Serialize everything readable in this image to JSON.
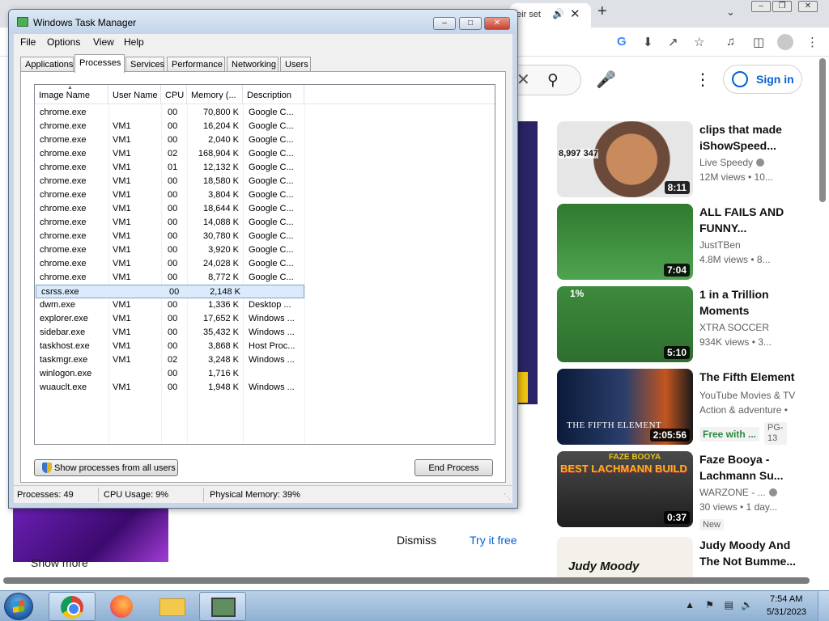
{
  "browser": {
    "tab_title": "eir set",
    "tab_icons": [
      "speaker-icon",
      "close-icon"
    ],
    "new_tab": "+",
    "window_buttons": [
      "minimize",
      "restore",
      "close"
    ],
    "toolbar_icons": [
      "google-icon",
      "download-icon",
      "share-icon",
      "star-icon",
      "media-icon",
      "sidebar-icon",
      "profile-icon",
      "menu-icon"
    ]
  },
  "youtube": {
    "sign_in": "Sign in",
    "dismiss": "Dismiss",
    "try_free": "Try it free",
    "show_more": "Show more",
    "videos": [
      {
        "title": "clips that made\niShowSpeed...",
        "channel": "Live Speedy",
        "verified": true,
        "meta": "12M views • 10...",
        "duration": "8:11",
        "overlay": "8,997 347"
      },
      {
        "title": "ALL FAILS AND\nFUNNY...",
        "channel": "JustTBen",
        "verified": false,
        "meta": "4.8M views • 8...",
        "duration": "7:04"
      },
      {
        "title": "1 in a Trillion\nMoments",
        "channel": "XTRA SOCCER",
        "verified": false,
        "meta": "934K views • 3...",
        "duration": "5:10",
        "overlay": "1%"
      },
      {
        "title": "The Fifth Element",
        "channel": "YouTube Movies & TV",
        "verified": false,
        "meta": "Action & adventure •",
        "duration": "2:05:56",
        "free": "Free with ...",
        "rating": "PG-\n13",
        "overlay": "THE FIFTH ELEMENT"
      },
      {
        "title": "Faze Booya -\nLachmann Su...",
        "channel": "WARZONE - ...",
        "verified": true,
        "meta": "30 views • 1 day...",
        "duration": "0:37",
        "badge": "New",
        "overlay": "BEST LACHMANN BUILD",
        "overlay_top": "FAZE BOOYA"
      },
      {
        "title": "Judy Moody And\nThe Not Bumme...",
        "channel": "",
        "verified": false,
        "meta": "",
        "duration": "",
        "overlay": "Judy Moody"
      }
    ]
  },
  "taskmanager": {
    "title": "Windows Task Manager",
    "menus": [
      "File",
      "Options",
      "View",
      "Help"
    ],
    "tabs": [
      "Applications",
      "Processes",
      "Services",
      "Performance",
      "Networking",
      "Users"
    ],
    "active_tab": "Processes",
    "columns": [
      "Image Name",
      "User Name",
      "CPU",
      "Memory (...",
      "Description"
    ],
    "rows": [
      {
        "image": "chrome.exe",
        "user": "",
        "cpu": "00",
        "mem": "70,800 K",
        "desc": "Google C..."
      },
      {
        "image": "chrome.exe",
        "user": "VM1",
        "cpu": "00",
        "mem": "16,204 K",
        "desc": "Google C..."
      },
      {
        "image": "chrome.exe",
        "user": "VM1",
        "cpu": "00",
        "mem": "2,040 K",
        "desc": "Google C..."
      },
      {
        "image": "chrome.exe",
        "user": "VM1",
        "cpu": "02",
        "mem": "168,904 K",
        "desc": "Google C..."
      },
      {
        "image": "chrome.exe",
        "user": "VM1",
        "cpu": "01",
        "mem": "12,132 K",
        "desc": "Google C..."
      },
      {
        "image": "chrome.exe",
        "user": "VM1",
        "cpu": "00",
        "mem": "18,580 K",
        "desc": "Google C..."
      },
      {
        "image": "chrome.exe",
        "user": "VM1",
        "cpu": "00",
        "mem": "3,804 K",
        "desc": "Google C..."
      },
      {
        "image": "chrome.exe",
        "user": "VM1",
        "cpu": "00",
        "mem": "18,644 K",
        "desc": "Google C..."
      },
      {
        "image": "chrome.exe",
        "user": "VM1",
        "cpu": "00",
        "mem": "14,088 K",
        "desc": "Google C..."
      },
      {
        "image": "chrome.exe",
        "user": "VM1",
        "cpu": "00",
        "mem": "30,780 K",
        "desc": "Google C..."
      },
      {
        "image": "chrome.exe",
        "user": "VM1",
        "cpu": "00",
        "mem": "3,920 K",
        "desc": "Google C..."
      },
      {
        "image": "chrome.exe",
        "user": "VM1",
        "cpu": "00",
        "mem": "24,028 K",
        "desc": "Google C..."
      },
      {
        "image": "chrome.exe",
        "user": "VM1",
        "cpu": "00",
        "mem": "8,772 K",
        "desc": "Google C..."
      },
      {
        "image": "csrss.exe",
        "user": "",
        "cpu": "00",
        "mem": "2,148 K",
        "desc": "",
        "selected": true
      },
      {
        "image": "dwm.exe",
        "user": "VM1",
        "cpu": "00",
        "mem": "1,336 K",
        "desc": "Desktop ..."
      },
      {
        "image": "explorer.exe",
        "user": "VM1",
        "cpu": "00",
        "mem": "17,652 K",
        "desc": "Windows ..."
      },
      {
        "image": "sidebar.exe",
        "user": "VM1",
        "cpu": "00",
        "mem": "35,432 K",
        "desc": "Windows ..."
      },
      {
        "image": "taskhost.exe",
        "user": "VM1",
        "cpu": "00",
        "mem": "3,868 K",
        "desc": "Host Proc..."
      },
      {
        "image": "taskmgr.exe",
        "user": "VM1",
        "cpu": "02",
        "mem": "3,248 K",
        "desc": "Windows ..."
      },
      {
        "image": "winlogon.exe",
        "user": "",
        "cpu": "00",
        "mem": "1,716 K",
        "desc": ""
      },
      {
        "image": "wuauclt.exe",
        "user": "VM1",
        "cpu": "00",
        "mem": "1,948 K",
        "desc": "Windows ..."
      }
    ],
    "show_all_button": "Show processes from all users",
    "end_process_button": "End Process",
    "status": {
      "processes": "Processes: 49",
      "cpu": "CPU Usage: 9%",
      "memory": "Physical Memory: 39%"
    }
  },
  "taskbar": {
    "pinned": [
      "chrome",
      "firefox",
      "explorer",
      "task-manager"
    ],
    "active": "task-manager",
    "time": "7:54 AM",
    "date": "5/31/2023"
  }
}
